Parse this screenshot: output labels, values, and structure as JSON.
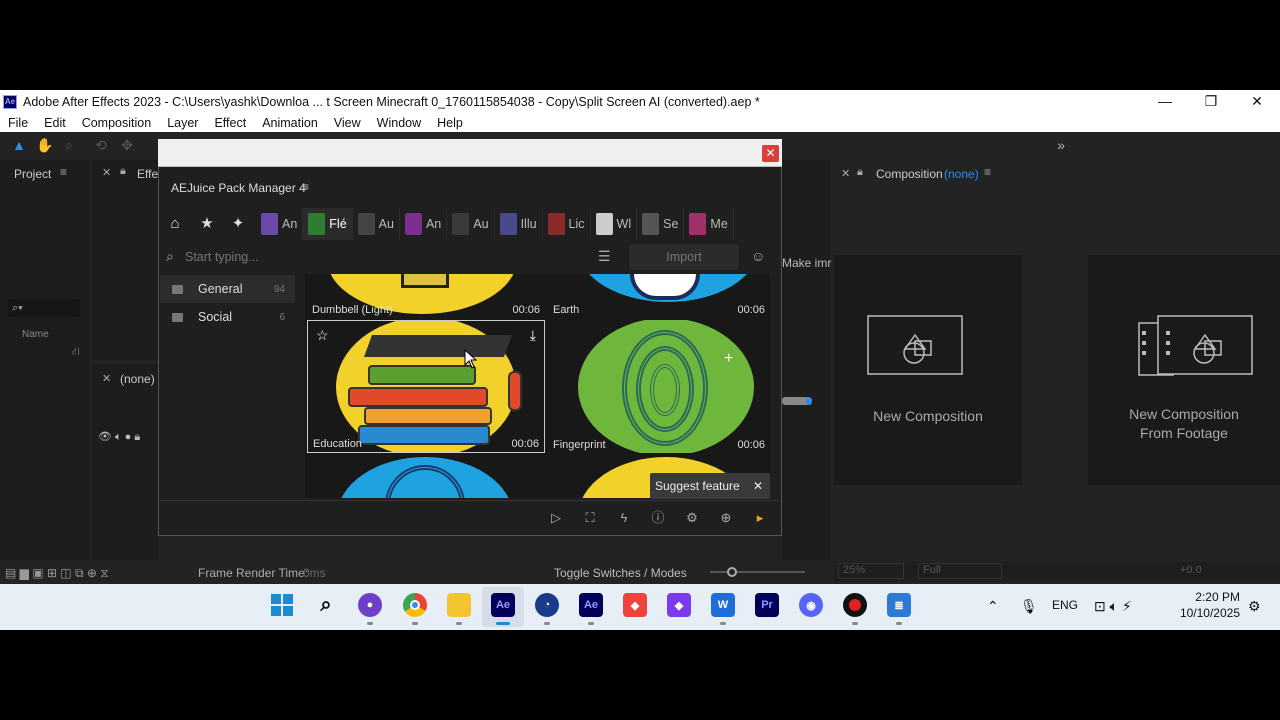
{
  "window": {
    "title": "Adobe After Effects 2023 - C:\\Users\\yashk\\Downloa ... t Screen Minecraft 0_1760115854038 - Copy\\Split Screen AI (converted).aep *",
    "logo": "Ae",
    "minimize": "—",
    "maximize": "❐",
    "close": "✕"
  },
  "menu": [
    "File",
    "Edit",
    "Composition",
    "Layer",
    "Effect",
    "Animation",
    "View",
    "Window",
    "Help"
  ],
  "panels": {
    "project_tab": "Project",
    "effects_tab": "Effe",
    "timeline_none": "(none)",
    "name_col": "Name",
    "make_label": "Make imr",
    "composition_tab": "Composition",
    "composition_none": "(none)",
    "frame_render": "Frame Render Time:",
    "frame_render_value": "0ms",
    "toggle_switches": "Toggle Switches / Modes",
    "zoom": "25%",
    "quality": "Full",
    "exposure": "+0.0"
  },
  "dialog": {
    "brand": "AEJuice Pack Manager 4",
    "close": "✕",
    "tabs": [
      {
        "label": "An",
        "color": "#6a4aa8"
      },
      {
        "label": "Flé",
        "color": "#2e7d32"
      },
      {
        "label": "Au",
        "color": "#444"
      },
      {
        "label": "An",
        "color": "#7b2f8f"
      },
      {
        "label": "Au",
        "color": "#3a3a3a"
      },
      {
        "label": "Illu",
        "color": "#4a4a8a"
      },
      {
        "label": "Lic",
        "color": "#8a2a2a"
      },
      {
        "label": "Wl",
        "color": "#cccccc"
      },
      {
        "label": "Se",
        "color": "#555"
      },
      {
        "label": "Me",
        "color": "#a0306a"
      }
    ],
    "search_placeholder": "Start typing...",
    "import_label": "Import",
    "categories": [
      {
        "name": "General",
        "count": "94"
      },
      {
        "name": "Social",
        "count": "6"
      }
    ],
    "tiles": [
      {
        "label": "Dumbbell (Light)",
        "time": "00:06"
      },
      {
        "label": "Earth",
        "time": "00:06"
      },
      {
        "label": "Education",
        "time": "00:06"
      },
      {
        "label": "Fingerprint",
        "time": "00:06"
      }
    ],
    "suggest_label": "Suggest feature",
    "suggest_close": "✕"
  },
  "composition_cards": [
    {
      "label": "New Composition"
    },
    {
      "label": "New Composition\nFrom Footage"
    }
  ],
  "taskbar": {
    "lang": "ENG",
    "time": "2:20 PM",
    "date": "10/10/2025",
    "apps": [
      "windows-start",
      "search",
      "github",
      "chrome",
      "file-explorer",
      "after-effects",
      "clock",
      "after-effects-2",
      "anydesk",
      "obsidian",
      "wps",
      "premiere",
      "discord",
      "obs",
      "notepad"
    ]
  },
  "colors": {
    "accent_blue": "#2d8ceb",
    "ae_purple": "#9999ff",
    "close_red": "#d9403a",
    "tile_yellow": "#f2d22a",
    "tile_green": "#6fb63c",
    "tile_blue": "#1fa3e0"
  }
}
